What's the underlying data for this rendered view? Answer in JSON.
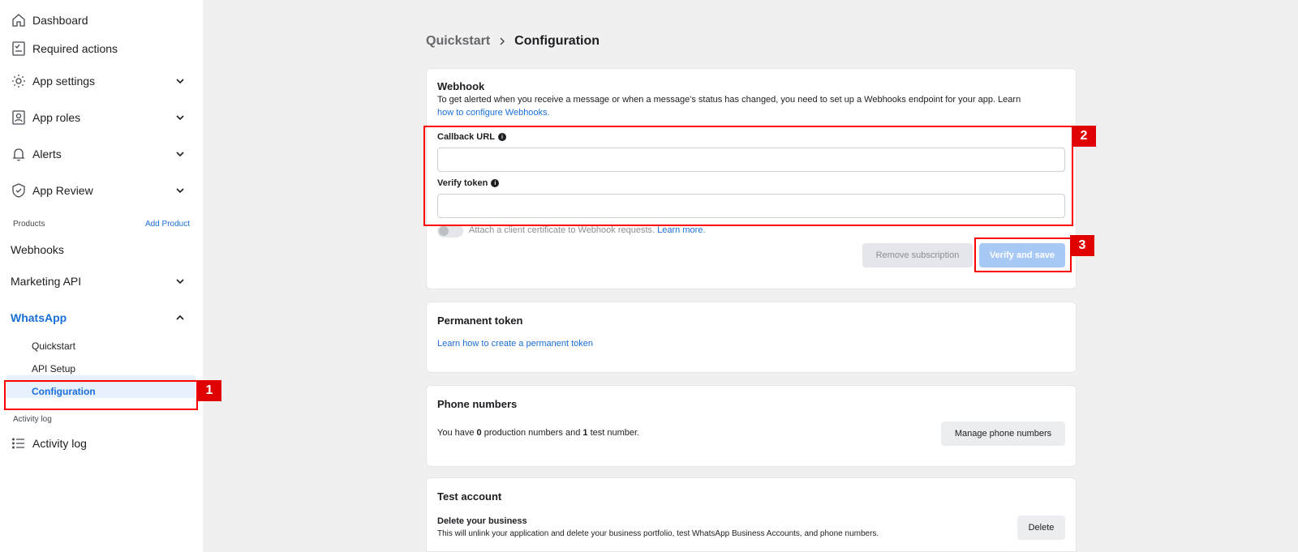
{
  "sidebar": {
    "items": [
      {
        "label": "Dashboard",
        "icon": "home-icon"
      },
      {
        "label": "Required actions",
        "icon": "checklist-icon"
      },
      {
        "label": "App settings",
        "icon": "gear-icon"
      },
      {
        "label": "App roles",
        "icon": "user-badge-icon"
      },
      {
        "label": "Alerts",
        "icon": "bell-icon"
      },
      {
        "label": "App Review",
        "icon": "shield-check-icon"
      }
    ],
    "products_label": "Products",
    "add_product": "Add Product",
    "products": [
      {
        "label": "Webhooks"
      },
      {
        "label": "Marketing API"
      },
      {
        "label": "WhatsApp"
      }
    ],
    "whatsapp_sub": [
      {
        "label": "Quickstart"
      },
      {
        "label": "API Setup"
      },
      {
        "label": "Configuration"
      }
    ],
    "activity_section": "Activity log",
    "activity_item": "Activity log"
  },
  "breadcrumb": {
    "parent": "Quickstart",
    "separator": ">",
    "current": "Configuration"
  },
  "webhook": {
    "title": "Webhook",
    "description": "To get alerted when you receive a message or when a message's status has changed, you need to set up a Webhooks endpoint for your app. Learn",
    "description_link": "how to configure Webhooks.",
    "callback_label": "Callback URL",
    "callback_value": "",
    "verify_label": "Verify token",
    "verify_value": "",
    "cert_text": "Attach a client certificate to Webhook requests.",
    "cert_link": "Learn more.",
    "remove_button": "Remove subscription",
    "verify_button": "Verify and save"
  },
  "permanent_token": {
    "title": "Permanent token",
    "link": "Learn how to create a permanent token"
  },
  "phone_numbers": {
    "title": "Phone numbers",
    "text_prefix": "You have ",
    "production_count": "0",
    "text_mid": " production numbers and ",
    "test_count": "1",
    "text_suffix": " test number.",
    "button": "Manage phone numbers"
  },
  "test_account": {
    "title": "Test account",
    "subtitle": "Delete your business",
    "description": "This will unlink your application and delete your business portfolio, test WhatsApp Business Accounts, and phone numbers.",
    "button": "Delete"
  },
  "annotations": [
    "1",
    "2",
    "3"
  ],
  "colors": {
    "accent": "#1a6ed8",
    "annotation": "#ff0000"
  }
}
